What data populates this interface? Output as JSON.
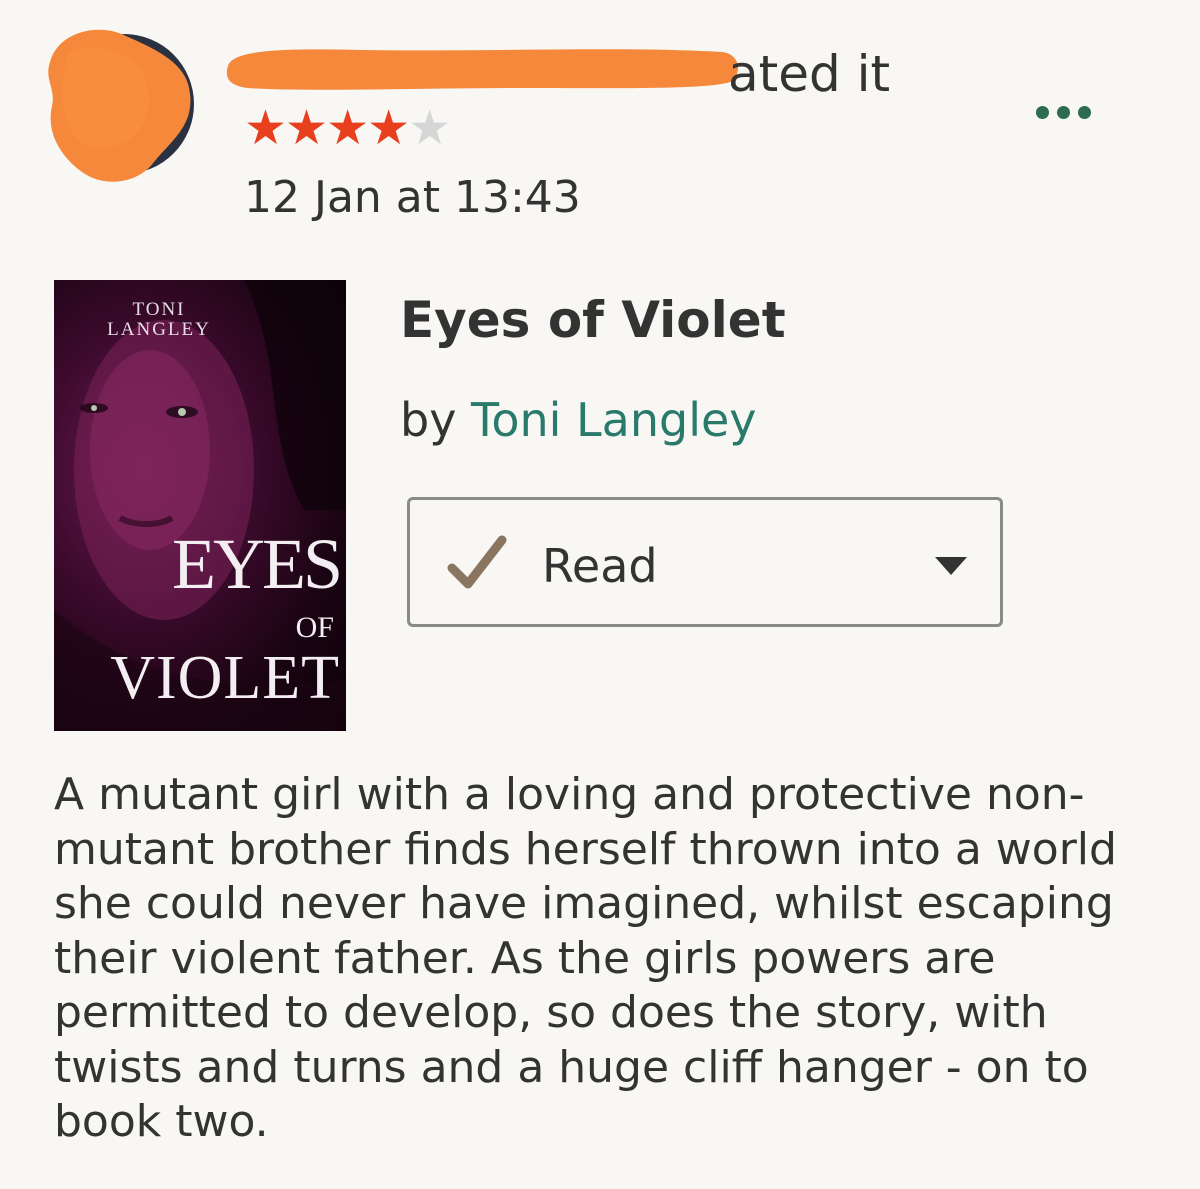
{
  "review": {
    "action_text": "ated it",
    "rating": 4,
    "rating_max": 5,
    "stars": {
      "filled": "★★★★",
      "empty": "★"
    },
    "timestamp": "12 Jan at 13:43"
  },
  "book": {
    "title": "Eyes of Violet",
    "by_prefix": "by",
    "author": "Toni Langley",
    "cover": {
      "author_line1": "TONI",
      "author_line2": "LANGLEY",
      "title_line1": "EYES",
      "title_line2": "OF",
      "title_line3": "VIOLET"
    }
  },
  "shelf": {
    "status": "Read",
    "check_icon": "checkmark-icon",
    "caret_icon": "caret-down-icon"
  },
  "review_text": "A mutant girl with a loving and protective non-mutant brother finds herself thrown into a world she could never have imagined, whilst escaping their violent father. As the girls powers are permitted to develop, so does the story, with twists and turns and a huge cliff hanger - on to book two.",
  "colors": {
    "background": "#f8f7f4",
    "star_filled": "#e8401f",
    "star_empty": "#d6d6d6",
    "author_link": "#2a7a6c",
    "menu_dots": "#2f6b4e",
    "checkmark": "#8a7560",
    "redaction": "#f5883a"
  }
}
